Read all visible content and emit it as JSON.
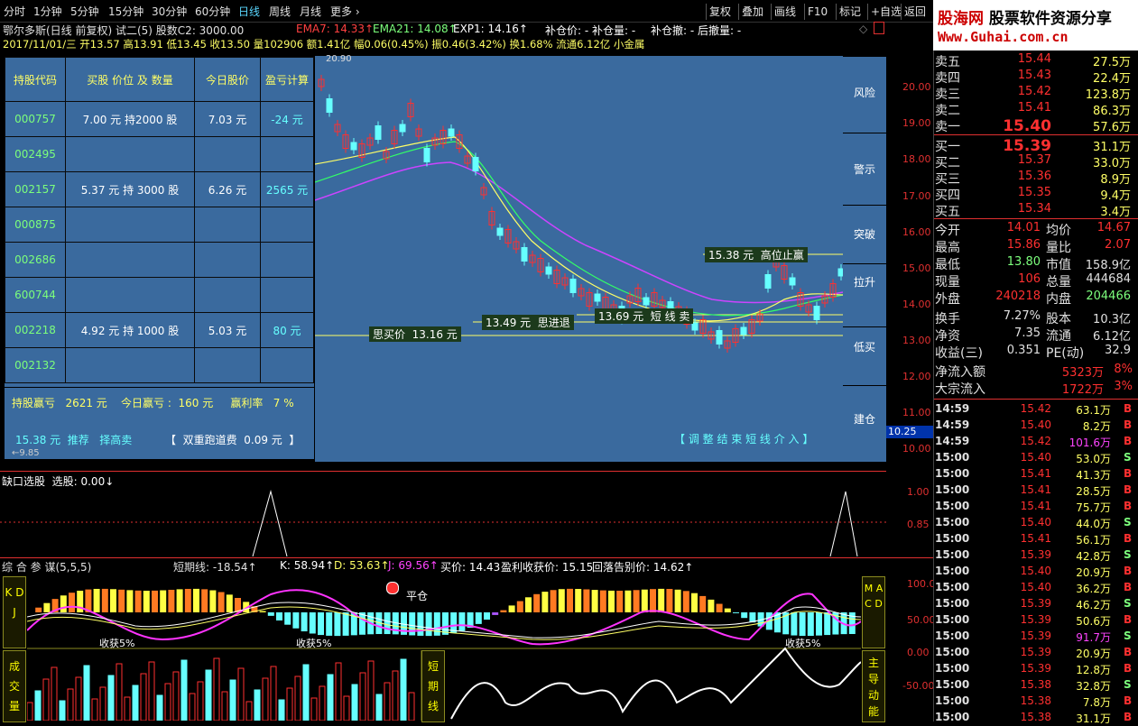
{
  "menu": {
    "items": [
      "分时",
      "1分钟",
      "5分钟",
      "15分钟",
      "30分钟",
      "60分钟",
      "日线",
      "周线",
      "月线",
      "更多 ›"
    ],
    "right": [
      "复权",
      "叠加",
      "画线",
      "F10",
      "标记",
      "+自选",
      "返回"
    ]
  },
  "logo": {
    "line1": "股海网",
    "line1b": "股票软件资源分享",
    "line2": "Www.Guhai.com.cn"
  },
  "header": {
    "stock": "鄂尔多斯(日线 前复权) 试二(5) 股数C2: 3000.00",
    "ema7": "EMA7: 14.33↑",
    "ema21": "EMA21: 14.08↑",
    "exp1": "EXP1: 14.16↑",
    "cang": "补仓价: -  补仓量: -",
    "chesan": "补仓撤: -  后撤量: -",
    "ohlc": "2017/11/01/三 开13.57 高13.91 低13.45 收13.50 量102906 额1.41亿 幅0.06(0.45%) 振0.46(3.42%) 换1.68% 流通6.12亿 小金属"
  },
  "holdings": {
    "headers": [
      "持股代码",
      "买股 价位 及 数量",
      "今日股价",
      "盈亏计算"
    ],
    "rows": [
      {
        "code": "000757",
        "buy": "7.00 元  持2000 股",
        "price": "7.03 元",
        "pl": "-24 元"
      },
      {
        "code": "002495",
        "buy": "",
        "price": "",
        "pl": ""
      },
      {
        "code": "002157",
        "buy": "5.37 元  持 3000 股",
        "price": "6.26 元",
        "pl": "2565 元"
      },
      {
        "code": "000875",
        "buy": "",
        "price": "",
        "pl": ""
      },
      {
        "code": "002686",
        "buy": "",
        "price": "",
        "pl": ""
      },
      {
        "code": "600744",
        "buy": "",
        "price": "",
        "pl": ""
      },
      {
        "code": "002218",
        "buy": "4.92 元  持 1000 股",
        "price": "5.03 元",
        "pl": "80 元"
      },
      {
        "code": "002132",
        "buy": "",
        "price": "",
        "pl": ""
      }
    ],
    "summary": "持股赢亏   2621 元    今日赢亏 :  160 元     赢利率   7 %",
    "recommend": "15.38 元  推荐   择高卖",
    "fee": "【  双重跑道费  0.09 元  】",
    "lowmark": "←9.85"
  },
  "chart": {
    "topmark": "20.90",
    "right_buttons": [
      "风险",
      "警示",
      "突破",
      "拉升",
      "低买",
      "建仓"
    ],
    "y_ticks": [
      "20.00",
      "19.00",
      "18.00",
      "17.00",
      "16.00",
      "15.00",
      "14.00",
      "13.00",
      "12.00",
      "11.00",
      "10.00"
    ],
    "current": "10.25",
    "labels": {
      "high_stop": "15.38 元  高位止赢",
      "short_sell": "13.69 元  短 线 卖",
      "think_retreat": "13.49 元  思进退",
      "think_buy": "思买价  13.16 元",
      "adjust": "【 调 整 结 束 短 线 介 入 】"
    }
  },
  "gap": {
    "title": "缺口选股  选股: 0.00↓",
    "ticks": [
      "1.00",
      "0.85"
    ]
  },
  "composite": {
    "title": "综 合 参 谋(5,5,5)",
    "short": "短期线: -18.54↑",
    "k": "K: 58.94↑",
    "d": "D: 53.63↑",
    "j": "J: 69.56↑",
    "buyprice": "买价: 14.43",
    "profit": "盈利收获价: 15.15",
    "warn": "回落告别价: 14.62↑",
    "ticks": [
      "100.0",
      "50.00",
      "0.00",
      "-50.00"
    ],
    "kdj": "K D J",
    "macd": "M A C D",
    "vol": "成 交 量",
    "shortline": "短 期 线",
    "force": "主 导 动 能",
    "pingcang": "平仓",
    "harvest": "收获5%"
  },
  "quote": {
    "asks": [
      [
        "卖五",
        "15.44",
        "27.5万"
      ],
      [
        "卖四",
        "15.43",
        "22.4万"
      ],
      [
        "卖三",
        "15.42",
        "123.8万"
      ],
      [
        "卖二",
        "15.41",
        "86.3万"
      ],
      [
        "卖一",
        "15.40",
        "57.6万"
      ]
    ],
    "bids": [
      [
        "买一",
        "15.39",
        "31.1万"
      ],
      [
        "买二",
        "15.37",
        "33.0万"
      ],
      [
        "买三",
        "15.36",
        "8.9万"
      ],
      [
        "买四",
        "15.35",
        "9.4万"
      ],
      [
        "买五",
        "15.34",
        "3.4万"
      ]
    ],
    "stats": [
      [
        "今开",
        "14.01",
        "均价",
        "14.67"
      ],
      [
        "最高",
        "15.86",
        "量比",
        "2.07"
      ],
      [
        "最低",
        "13.80",
        "市值",
        "158.9亿"
      ],
      [
        "现量",
        "106",
        "总量",
        "444684"
      ],
      [
        "外盘",
        "240218",
        "内盘",
        "204466"
      ],
      [
        "换手",
        "7.27%",
        "股本",
        "10.3亿"
      ],
      [
        "净资",
        "7.35",
        "流通",
        "6.12亿"
      ],
      [
        "收益(三)",
        "0.351",
        "PE(动)",
        "32.9"
      ]
    ],
    "flow": [
      [
        "净流入额",
        "5323万",
        "8%"
      ],
      [
        "大宗流入",
        "1722万",
        "3%"
      ]
    ],
    "ticks": [
      [
        "14:59",
        "15.42",
        "63.1万",
        "B"
      ],
      [
        "14:59",
        "15.40",
        "8.2万",
        "B"
      ],
      [
        "14:59",
        "15.42",
        "101.6万",
        "B"
      ],
      [
        "15:00",
        "15.40",
        "53.0万",
        "S"
      ],
      [
        "15:00",
        "15.41",
        "41.3万",
        "B"
      ],
      [
        "15:00",
        "15.41",
        "28.5万",
        "B"
      ],
      [
        "15:00",
        "15.41",
        "75.7万",
        "B"
      ],
      [
        "15:00",
        "15.40",
        "44.0万",
        "S"
      ],
      [
        "15:00",
        "15.41",
        "56.1万",
        "B"
      ],
      [
        "15:00",
        "15.39",
        "42.8万",
        "S"
      ],
      [
        "15:00",
        "15.40",
        "20.9万",
        "B"
      ],
      [
        "15:00",
        "15.40",
        "36.2万",
        "B"
      ],
      [
        "15:00",
        "15.39",
        "46.2万",
        "S"
      ],
      [
        "15:00",
        "15.39",
        "50.6万",
        "B"
      ],
      [
        "15:00",
        "15.39",
        "91.7万",
        "S"
      ],
      [
        "15:00",
        "15.39",
        "20.9万",
        "B"
      ],
      [
        "15:00",
        "15.39",
        "12.8万",
        "B"
      ],
      [
        "15:00",
        "15.38",
        "32.8万",
        "S"
      ],
      [
        "15:00",
        "15.38",
        "7.8万",
        "B"
      ],
      [
        "15:00",
        "15.38",
        "31.1万",
        "B"
      ]
    ]
  },
  "colors": {
    "up": "#ff3030",
    "down": "#66ffff",
    "bg": "#3a6a9e",
    "yellow": "#ffff00"
  }
}
